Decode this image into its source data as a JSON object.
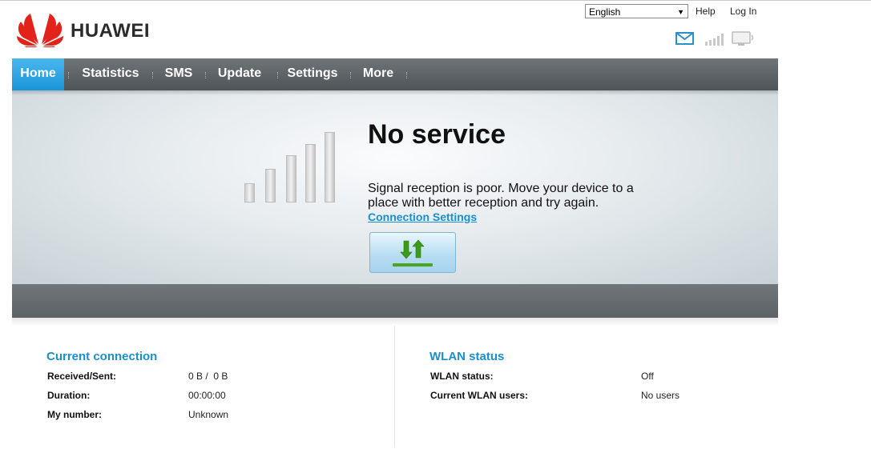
{
  "header": {
    "brand": "HUAWEI",
    "language": "English",
    "help_label": "Help",
    "login_label": "Log In",
    "icons": [
      "mail-icon",
      "signal-strength-icon",
      "connection-status-icon"
    ]
  },
  "nav": {
    "items": [
      {
        "label": "Home",
        "active": true
      },
      {
        "label": "Statistics"
      },
      {
        "label": "SMS"
      },
      {
        "label": "Update"
      },
      {
        "label": "Settings"
      },
      {
        "label": "More"
      }
    ]
  },
  "hero": {
    "title": "No service",
    "message": "Signal reception is poor. Move your device to a place with better reception and try again.",
    "link_label": "Connection Settings",
    "button_icon": "connect-arrows-icon"
  },
  "current_connection": {
    "title": "Current connection",
    "rows": [
      {
        "label": "Received/Sent:",
        "value": "0 B /  0 B"
      },
      {
        "label": "Duration:",
        "value": "00:00:00"
      },
      {
        "label": "My number:",
        "value": "Unknown"
      }
    ]
  },
  "wlan": {
    "title": "WLAN status",
    "rows": [
      {
        "label": "WLAN status:",
        "value": "Off"
      },
      {
        "label": "Current WLAN users:",
        "value": "No users"
      }
    ]
  },
  "colors": {
    "accent": "#1a8fcf",
    "nav_active": "#29a6e6",
    "brand_red": "#e2231a"
  }
}
